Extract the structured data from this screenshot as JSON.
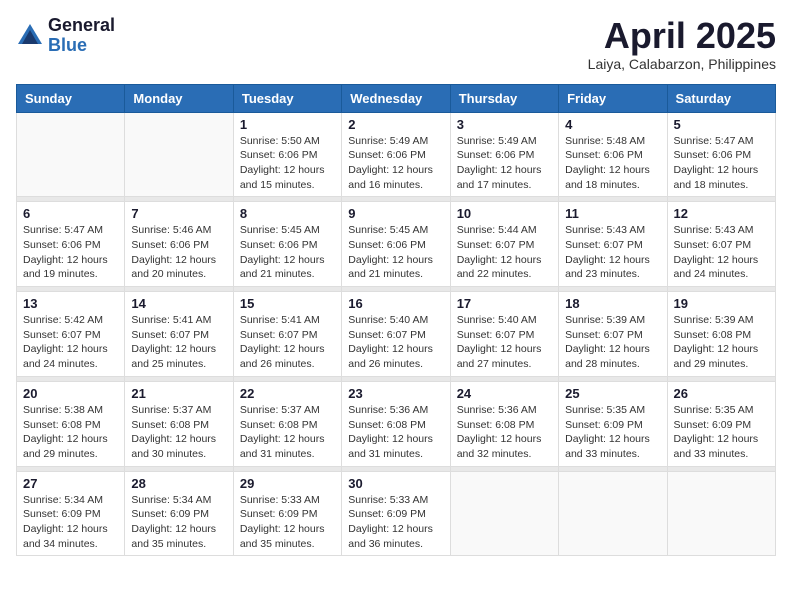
{
  "logo": {
    "general": "General",
    "blue": "Blue"
  },
  "title": "April 2025",
  "location": "Laiya, Calabarzon, Philippines",
  "days_of_week": [
    "Sunday",
    "Monday",
    "Tuesday",
    "Wednesday",
    "Thursday",
    "Friday",
    "Saturday"
  ],
  "weeks": [
    [
      {
        "day": "",
        "info": ""
      },
      {
        "day": "",
        "info": ""
      },
      {
        "day": "1",
        "info": "Sunrise: 5:50 AM\nSunset: 6:06 PM\nDaylight: 12 hours\nand 15 minutes."
      },
      {
        "day": "2",
        "info": "Sunrise: 5:49 AM\nSunset: 6:06 PM\nDaylight: 12 hours\nand 16 minutes."
      },
      {
        "day": "3",
        "info": "Sunrise: 5:49 AM\nSunset: 6:06 PM\nDaylight: 12 hours\nand 17 minutes."
      },
      {
        "day": "4",
        "info": "Sunrise: 5:48 AM\nSunset: 6:06 PM\nDaylight: 12 hours\nand 18 minutes."
      },
      {
        "day": "5",
        "info": "Sunrise: 5:47 AM\nSunset: 6:06 PM\nDaylight: 12 hours\nand 18 minutes."
      }
    ],
    [
      {
        "day": "6",
        "info": "Sunrise: 5:47 AM\nSunset: 6:06 PM\nDaylight: 12 hours\nand 19 minutes."
      },
      {
        "day": "7",
        "info": "Sunrise: 5:46 AM\nSunset: 6:06 PM\nDaylight: 12 hours\nand 20 minutes."
      },
      {
        "day": "8",
        "info": "Sunrise: 5:45 AM\nSunset: 6:06 PM\nDaylight: 12 hours\nand 21 minutes."
      },
      {
        "day": "9",
        "info": "Sunrise: 5:45 AM\nSunset: 6:06 PM\nDaylight: 12 hours\nand 21 minutes."
      },
      {
        "day": "10",
        "info": "Sunrise: 5:44 AM\nSunset: 6:07 PM\nDaylight: 12 hours\nand 22 minutes."
      },
      {
        "day": "11",
        "info": "Sunrise: 5:43 AM\nSunset: 6:07 PM\nDaylight: 12 hours\nand 23 minutes."
      },
      {
        "day": "12",
        "info": "Sunrise: 5:43 AM\nSunset: 6:07 PM\nDaylight: 12 hours\nand 24 minutes."
      }
    ],
    [
      {
        "day": "13",
        "info": "Sunrise: 5:42 AM\nSunset: 6:07 PM\nDaylight: 12 hours\nand 24 minutes."
      },
      {
        "day": "14",
        "info": "Sunrise: 5:41 AM\nSunset: 6:07 PM\nDaylight: 12 hours\nand 25 minutes."
      },
      {
        "day": "15",
        "info": "Sunrise: 5:41 AM\nSunset: 6:07 PM\nDaylight: 12 hours\nand 26 minutes."
      },
      {
        "day": "16",
        "info": "Sunrise: 5:40 AM\nSunset: 6:07 PM\nDaylight: 12 hours\nand 26 minutes."
      },
      {
        "day": "17",
        "info": "Sunrise: 5:40 AM\nSunset: 6:07 PM\nDaylight: 12 hours\nand 27 minutes."
      },
      {
        "day": "18",
        "info": "Sunrise: 5:39 AM\nSunset: 6:07 PM\nDaylight: 12 hours\nand 28 minutes."
      },
      {
        "day": "19",
        "info": "Sunrise: 5:39 AM\nSunset: 6:08 PM\nDaylight: 12 hours\nand 29 minutes."
      }
    ],
    [
      {
        "day": "20",
        "info": "Sunrise: 5:38 AM\nSunset: 6:08 PM\nDaylight: 12 hours\nand 29 minutes."
      },
      {
        "day": "21",
        "info": "Sunrise: 5:37 AM\nSunset: 6:08 PM\nDaylight: 12 hours\nand 30 minutes."
      },
      {
        "day": "22",
        "info": "Sunrise: 5:37 AM\nSunset: 6:08 PM\nDaylight: 12 hours\nand 31 minutes."
      },
      {
        "day": "23",
        "info": "Sunrise: 5:36 AM\nSunset: 6:08 PM\nDaylight: 12 hours\nand 31 minutes."
      },
      {
        "day": "24",
        "info": "Sunrise: 5:36 AM\nSunset: 6:08 PM\nDaylight: 12 hours\nand 32 minutes."
      },
      {
        "day": "25",
        "info": "Sunrise: 5:35 AM\nSunset: 6:09 PM\nDaylight: 12 hours\nand 33 minutes."
      },
      {
        "day": "26",
        "info": "Sunrise: 5:35 AM\nSunset: 6:09 PM\nDaylight: 12 hours\nand 33 minutes."
      }
    ],
    [
      {
        "day": "27",
        "info": "Sunrise: 5:34 AM\nSunset: 6:09 PM\nDaylight: 12 hours\nand 34 minutes."
      },
      {
        "day": "28",
        "info": "Sunrise: 5:34 AM\nSunset: 6:09 PM\nDaylight: 12 hours\nand 35 minutes."
      },
      {
        "day": "29",
        "info": "Sunrise: 5:33 AM\nSunset: 6:09 PM\nDaylight: 12 hours\nand 35 minutes."
      },
      {
        "day": "30",
        "info": "Sunrise: 5:33 AM\nSunset: 6:09 PM\nDaylight: 12 hours\nand 36 minutes."
      },
      {
        "day": "",
        "info": ""
      },
      {
        "day": "",
        "info": ""
      },
      {
        "day": "",
        "info": ""
      }
    ]
  ]
}
